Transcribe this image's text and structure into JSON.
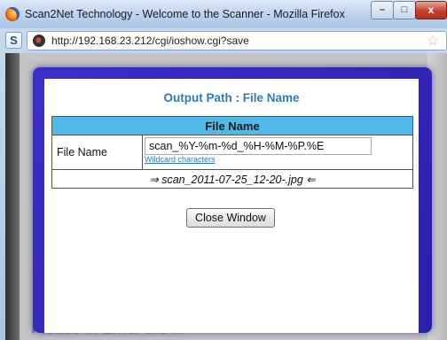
{
  "window": {
    "title": "Scan2Net Technology - Welcome to the Scanner - Mozilla Firefox",
    "buttons": {
      "minimize": "–",
      "maximize": "□",
      "close": "x"
    }
  },
  "address_bar": {
    "site_letter": "S",
    "url": "http://192.168.23.212/cgi/ioshow.cgi?save"
  },
  "dialog": {
    "title": "Output Path : File Name",
    "table_header": "File Name",
    "field_label": "File Name",
    "field_value": "scan_%Y-%m-%d_%H-%M-%P.%E",
    "wildcard_link": "Wildcard characters",
    "preview": "⇒ scan_2011-07-25_12-20-.jpg ⇐",
    "close_button": "Close Window"
  },
  "background": {
    "blurred_text": "Please ... Enter the ... "
  },
  "icons": {
    "browser_logo": "firefox-logo-icon",
    "site_favicon": "site-favicon-icon",
    "bookmark": "bookmark-star-icon"
  },
  "colors": {
    "dialog_frame": "#3b30c8",
    "title_text": "#3279b8",
    "table_header_bg": "#4fb9ea"
  }
}
